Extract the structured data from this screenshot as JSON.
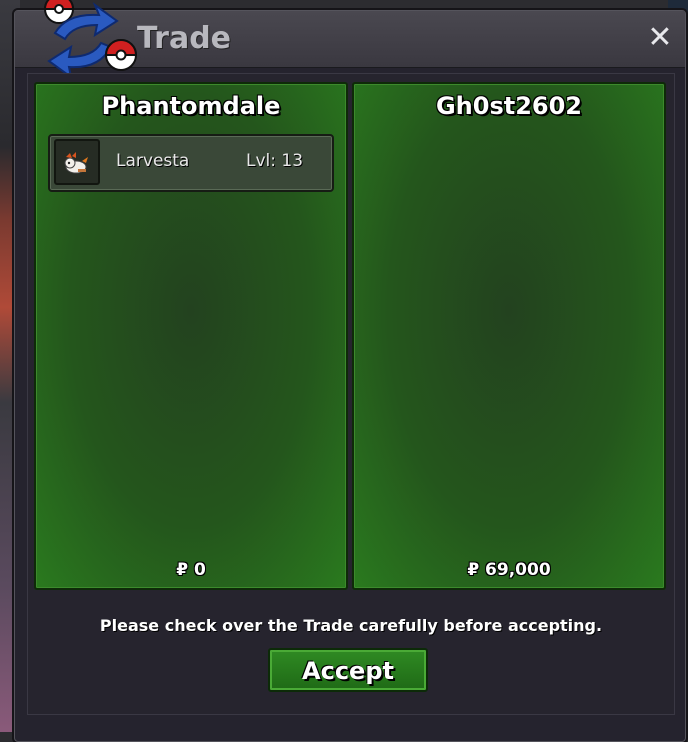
{
  "window": {
    "title": "Trade",
    "close_symbol": "✕"
  },
  "left_panel": {
    "player": "Phantomdale",
    "items": [
      {
        "name": "Larvesta",
        "level": "Lvl: 13",
        "icon": "larvesta-sprite"
      }
    ],
    "money": "₽ 0"
  },
  "right_panel": {
    "player": "Gh0st2602",
    "items": [],
    "money": "₽ 69,000"
  },
  "footer": {
    "notice": "Please check over the Trade carefully before accepting.",
    "accept_label": "Accept"
  },
  "colors": {
    "panel_green": "#24561c",
    "button_green": "#2f8a23",
    "window_bg": "#25232e"
  }
}
